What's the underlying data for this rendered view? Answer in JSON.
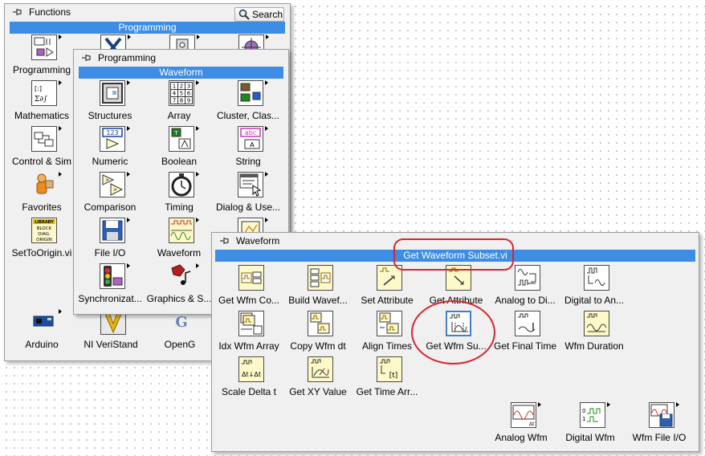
{
  "functions_palette": {
    "title": "Functions",
    "search_label": "Search",
    "subbar": "Programming",
    "items": {
      "programming": "Programming",
      "mathematics": "Mathematics",
      "control_sim": "Control & Sim",
      "favorites": "Favorites",
      "settoorigin": "SetToOrigin.vi",
      "arduino": "Arduino",
      "ni_veristand": "NI VeriStand",
      "openg": "OpenG"
    }
  },
  "programming_palette": {
    "title": "Programming",
    "subbar": "Waveform",
    "items": {
      "structures": "Structures",
      "array": "Array",
      "cluster": "Cluster, Clas...",
      "numeric": "Numeric",
      "boolean": "Boolean",
      "string": "String",
      "comparison": "Comparison",
      "timing": "Timing",
      "dialog": "Dialog & Use...",
      "file_io": "File I/O",
      "waveform": "Waveform",
      "synchronization": "Synchronizat...",
      "graphics": "Graphics & S..."
    }
  },
  "waveform_palette": {
    "title": "Waveform",
    "subbar": "Get Waveform Subset.vi",
    "items": {
      "get_wfm_co": "Get Wfm Co...",
      "build_wave": "Build Wavef...",
      "set_attribute": "Set Attribute",
      "get_attribute": "Get Attribute",
      "analog_to_di": "Analog to Di...",
      "digital_to_an": "Digital to An...",
      "idx_wfm_array": "Idx Wfm Array",
      "copy_wfm_dt": "Copy Wfm dt",
      "align_times": "Align Times",
      "get_wfm_su": "Get Wfm Su...",
      "get_final_time": "Get Final Time",
      "wfm_duration": "Wfm Duration",
      "scale_delta_t": "Scale Delta t",
      "get_xy_value": "Get XY Value",
      "get_time_arr": "Get Time Arr...",
      "analog_wfm": "Analog Wfm",
      "digital_wfm": "Digital Wfm",
      "wfm_file_io": "Wfm File I/O"
    },
    "icon_text": {
      "array_cells": [
        "1",
        "2",
        "3",
        "4",
        "5",
        "6",
        "7",
        "8",
        "9"
      ],
      "numeric_123": "123",
      "boolean_tf": "TF",
      "string_abc": "abc",
      "string_a": "A",
      "library": "LIBRARY",
      "block": "BLOCK",
      "diag": "DIAG.",
      "origin": "ORIGIN"
    }
  },
  "colors": {
    "subbar": "#3d8de6",
    "highlight_annotation": "#d9232f",
    "palette_bg": "#f0f0f0",
    "waveform_icon_bg": "#fff8c8"
  }
}
